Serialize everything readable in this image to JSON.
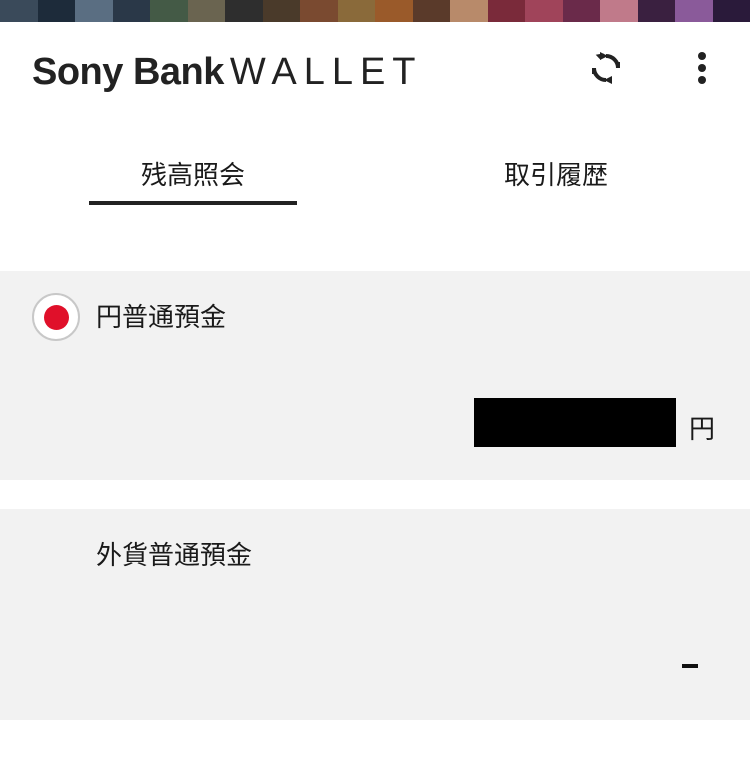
{
  "header": {
    "brand_bold": "Sony Bank",
    "brand_light": "WALLET",
    "refresh_icon": "refresh-icon",
    "menu_icon": "more-vertical-icon"
  },
  "tabs": [
    {
      "label": "残高照会",
      "active": true
    },
    {
      "label": "取引履歴",
      "active": false
    }
  ],
  "accounts": {
    "yen": {
      "name": "円普通預金",
      "flag_icon": "japan-flag-icon",
      "balance": "",
      "balance_masked": true,
      "currency_unit": "円"
    },
    "foreign": {
      "name": "外貨普通預金",
      "balance": "-"
    }
  },
  "colors": {
    "accent": "#222222",
    "panel_bg": "#f2f2f2",
    "flag_red": "#e0102a"
  }
}
